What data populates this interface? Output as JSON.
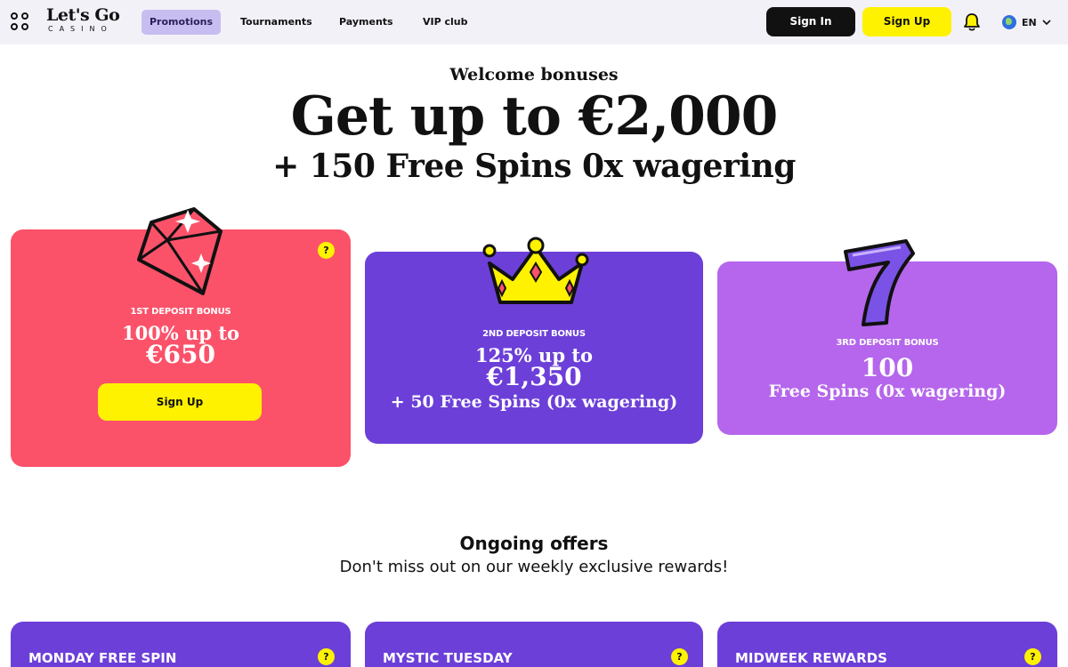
{
  "header": {
    "logo_main": "Let's Go",
    "logo_sub": "CASINO",
    "nav": [
      {
        "label": "Promotions",
        "active": true
      },
      {
        "label": "Tournaments",
        "active": false
      },
      {
        "label": "Payments",
        "active": false
      },
      {
        "label": "VIP club",
        "active": false
      }
    ],
    "signin_label": "Sign In",
    "signup_label": "Sign Up",
    "language": "EN",
    "icons": [
      "menu-grid-icon",
      "bell-icon",
      "globe-icon",
      "chevron-down-icon"
    ]
  },
  "hero": {
    "eyebrow": "Welcome bonuses",
    "title": "Get up to €2,000",
    "subtitle": "+ 150 Free Spins 0x wagering"
  },
  "bonuses": [
    {
      "label": "1ST DEPOSIT BONUS",
      "line1": "100% up to",
      "line2": "€650",
      "cta": "Sign Up",
      "help": "?",
      "illustration": "diamond-icon",
      "color": "#fb526a"
    },
    {
      "label": "2ND DEPOSIT BONUS",
      "line1": "125% up to",
      "line2": "€1,350",
      "line3": "+ 50 Free Spins (0x wagering)",
      "illustration": "crown-icon",
      "color": "#6c3fd8"
    },
    {
      "label": "3RD DEPOSIT BONUS",
      "line1": "100",
      "line2": "Free Spins (0x wagering)",
      "illustration": "seven-icon",
      "color": "#b566ec"
    }
  ],
  "ongoing": {
    "title": "Ongoing offers",
    "subtitle": "Don't miss out on our weekly exclusive rewards!",
    "offers": [
      {
        "title": "MONDAY FREE SPIN",
        "help": "?"
      },
      {
        "title": "MYSTIC TUESDAY",
        "help": "?"
      },
      {
        "title": "MIDWEEK REWARDS",
        "help": "?"
      }
    ]
  },
  "colors": {
    "accent_yellow": "#fff200",
    "header_bg": "#f3f1f8",
    "nav_active_bg": "#c8bdf0",
    "purple": "#6c3fd8",
    "lilac": "#b566ec",
    "coral": "#fb526a"
  }
}
